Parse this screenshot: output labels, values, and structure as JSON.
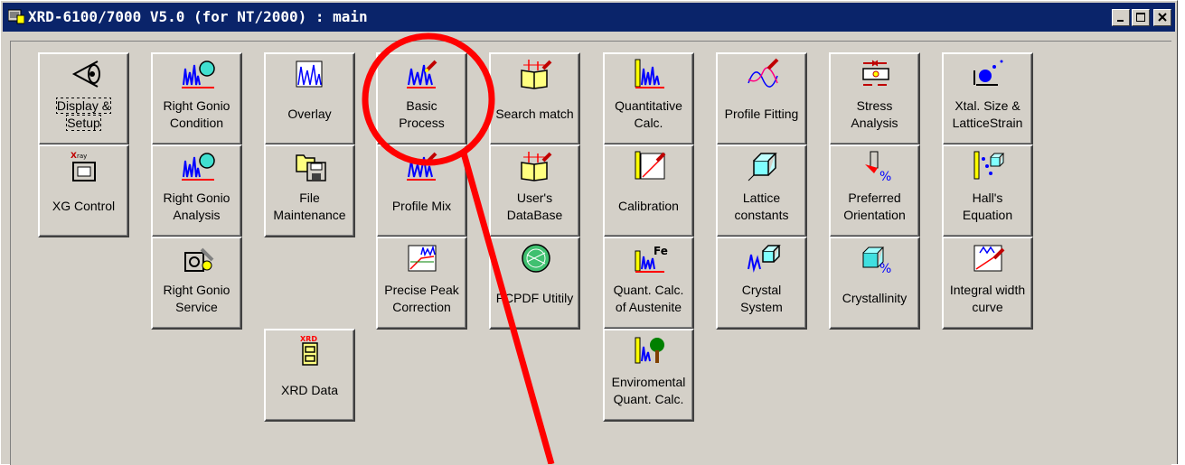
{
  "window": {
    "title": "XRD-6100/7000 V5.0 (for NT/2000) : main"
  },
  "tiles": [
    {
      "label": "Display &\nSetup",
      "icon": "eye-icon"
    },
    {
      "label": "XG Control",
      "icon": "xray-generator-icon"
    },
    {
      "label": "Right Gonio\nCondition",
      "icon": "gonio-condition-icon"
    },
    {
      "label": "Right Gonio\nAnalysis",
      "icon": "gonio-analysis-icon"
    },
    {
      "label": "Right Gonio\nService",
      "icon": "gonio-service-icon"
    },
    {
      "label": "Overlay",
      "icon": "overlay-icon"
    },
    {
      "label": "File\nMaintenance",
      "icon": "file-maintenance-icon"
    },
    {
      "label": "XRD Data",
      "icon": "xrd-data-icon"
    },
    {
      "label": "Basic\nProcess",
      "icon": "basic-process-icon"
    },
    {
      "label": "Profile Mix",
      "icon": "profile-mix-icon"
    },
    {
      "label": "Precise Peak\nCorrection",
      "icon": "precise-peak-icon"
    },
    {
      "label": "Search match",
      "icon": "search-match-icon"
    },
    {
      "label": "User's\nDataBase",
      "icon": "user-database-icon"
    },
    {
      "label": "PCPDF Utitily",
      "icon": "pcpdf-utility-icon"
    },
    {
      "label": "Quantitative\nCalc.",
      "icon": "quantitative-calc-icon"
    },
    {
      "label": "Calibration",
      "icon": "calibration-icon"
    },
    {
      "label": "Quant. Calc.\nof Austenite",
      "icon": "austenite-icon"
    },
    {
      "label": "Enviromental\nQuant. Calc.",
      "icon": "environmental-icon"
    },
    {
      "label": "Profile Fitting",
      "icon": "profile-fitting-icon"
    },
    {
      "label": "Lattice\nconstants",
      "icon": "lattice-constants-icon"
    },
    {
      "label": "Crystal\nSystem",
      "icon": "crystal-system-icon"
    },
    {
      "label": "Stress\nAnalysis",
      "icon": "stress-analysis-icon"
    },
    {
      "label": "Preferred\nOrientation",
      "icon": "preferred-orientation-icon"
    },
    {
      "label": "Crystallinity",
      "icon": "crystallinity-icon"
    },
    {
      "label": "Xtal. Size &\nLatticeStrain",
      "icon": "xtal-size-icon"
    },
    {
      "label": "Hall's\nEquation",
      "icon": "halls-equation-icon"
    },
    {
      "label": "Integral width\ncurve",
      "icon": "integral-width-icon"
    }
  ],
  "annotation": {
    "color": "#ff0000"
  },
  "colors": {
    "titlebar": "#0a246a",
    "face": "#d4d0c8",
    "peaks": "#0000ff",
    "axis": "#ff0000"
  }
}
